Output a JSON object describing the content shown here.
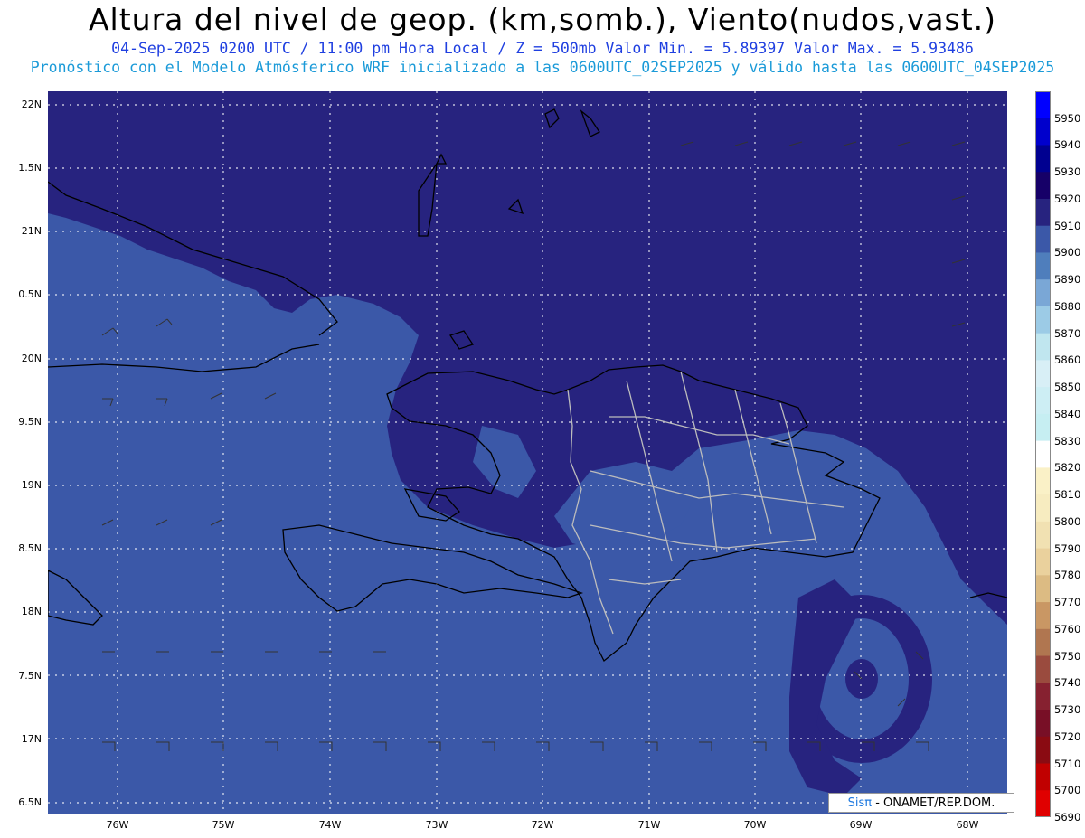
{
  "header": {
    "title": "Altura del nivel de geop. (km,somb.), Viento(nudos,vast.)",
    "line1": "04-Sep-2025  0200 UTC / 11:00 pm Hora Local / Z = 500mb   Valor Min. = 5.89397  Valor Max. = 5.93486",
    "line2": "Pronóstico con el Modelo Atmósferico WRF inicializado a las 0600UTC_02SEP2025 y válido hasta las  0600UTC_04SEP2025"
  },
  "axes": {
    "lat_labels": [
      "22N",
      "1.5N",
      "21N",
      "0.5N",
      "20N",
      "9.5N",
      "19N",
      "8.5N",
      "18N",
      "7.5N",
      "17N",
      "6.5N"
    ],
    "lon_labels": [
      "76W",
      "75W",
      "74W",
      "73W",
      "72W",
      "71W",
      "70W",
      "69W",
      "68W"
    ]
  },
  "colorbar": {
    "levels": [
      5950,
      5940,
      5930,
      5920,
      5910,
      5900,
      5890,
      5880,
      5870,
      5860,
      5850,
      5840,
      5830,
      5820,
      5810,
      5800,
      5790,
      5780,
      5770,
      5760,
      5750,
      5740,
      5730,
      5720,
      5710,
      5700,
      5690
    ],
    "colors": [
      "#0000ff",
      "#0000cc",
      "#000090",
      "#160068",
      "#27237f",
      "#3b58a8",
      "#4f7ebc",
      "#7aa7d6",
      "#9ccbe6",
      "#c0e6ef",
      "#d8eff6",
      "#cdeef4",
      "#c6eef2",
      "#ffffff",
      "#faf1c7",
      "#f7ecc0",
      "#f1e1b2",
      "#ead19d",
      "#dcbb83",
      "#c99764",
      "#b07650",
      "#9a4b3e",
      "#862130",
      "#780f26",
      "#8a0b12",
      "#c00000",
      "#e00000"
    ]
  },
  "map": {
    "fill_dark": "#27237f",
    "fill_mid": "#3b58a8",
    "grid_color": "#ffffff",
    "coast_color": "#000000",
    "border_color": "#bdbdbd",
    "barb_color": "#333333"
  },
  "credit": {
    "brand": "Sisπ",
    "org": " - ONAMET/REP.DOM."
  }
}
